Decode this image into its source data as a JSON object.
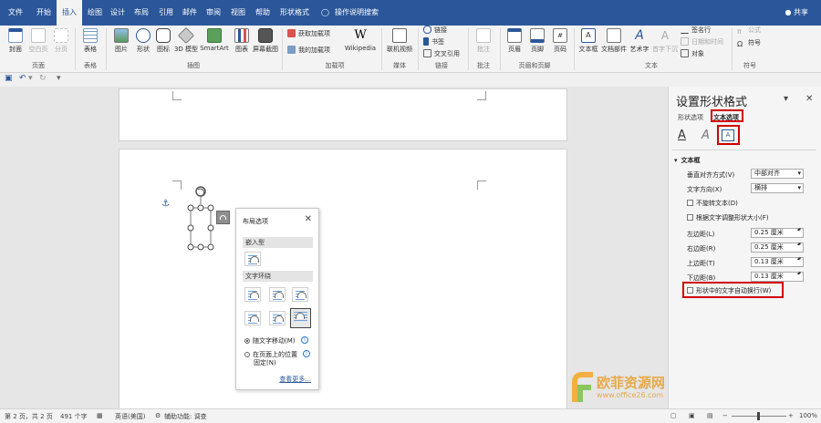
{
  "tabs": [
    "文件",
    "开始",
    "插入",
    "绘图",
    "设计",
    "布局",
    "引用",
    "邮件",
    "审阅",
    "视图",
    "帮助",
    "形状格式"
  ],
  "active_tab": "插入",
  "search_label": "操作说明搜索",
  "share_label": "共享",
  "ribbon": {
    "pages": {
      "cover": "封面",
      "blank": "空白页",
      "break": "分页",
      "group": "页面"
    },
    "tables": {
      "table": "表格",
      "group": "表格"
    },
    "illus": {
      "picture": "图片",
      "shapes": "形状",
      "icons": "图标",
      "model3d": "3D 模型",
      "smartart": "SmartArt",
      "chart": "图表",
      "screenshot": "屏幕截图",
      "group": "插图"
    },
    "addins": {
      "get": "获取加载项",
      "my": "我的加载项",
      "wikipedia": "Wikipedia",
      "group": "加载项"
    },
    "media": {
      "video": "联机视频",
      "group": "媒体"
    },
    "links": {
      "link": "链接",
      "bookmark": "书签",
      "crossref": "交叉引用",
      "group": "链接"
    },
    "comments": {
      "comment": "批注",
      "group": "批注"
    },
    "hf": {
      "header": "页眉",
      "footer": "页脚",
      "pagenum": "页码",
      "group": "页眉和页脚"
    },
    "text": {
      "textbox": "文本框",
      "parts": "文档部件",
      "wordart": "艺术字",
      "dropcap": "首字下沉",
      "signature": "签名行",
      "datetime": "日期和时间",
      "object": "对象",
      "group": "文本"
    },
    "symbols": {
      "equation": "公式",
      "symbol": "符号",
      "group": "符号"
    }
  },
  "layout_popup": {
    "title": "布局选项",
    "inline_section": "嵌入型",
    "wrap_section": "文字环绕",
    "move_with_text": "随文字移动(M)",
    "fix_position_line1": "在页面上的位置",
    "fix_position_line2": "固定(N)",
    "see_more": "查看更多..."
  },
  "format_pane": {
    "title": "设置形状格式",
    "tab_shape": "形状选项",
    "tab_text": "文本选项",
    "section": "文本框",
    "valign_label": "垂直对齐方式(V)",
    "valign_value": "中部对齐",
    "direction_label": "文字方向(X)",
    "direction_value": "横排",
    "no_rotate": "不旋转文本(D)",
    "autofit": "根据文字调整形状大小(F)",
    "left_margin_label": "左边距(L)",
    "left_margin_value": "0.25 厘米",
    "right_margin_label": "右边距(R)",
    "right_margin_value": "0.25 厘米",
    "top_margin_label": "上边距(T)",
    "top_margin_value": "0.13 厘米",
    "bottom_margin_label": "下边距(B)",
    "bottom_margin_value": "0.13 厘米",
    "wrap_text": "形状中的文字自动换行(W)"
  },
  "status": {
    "page": "第 2 页，共 2 页",
    "words": "491 个字",
    "lang": "英语(美国)",
    "access": "辅助功能: 调查",
    "zoom": "100%"
  },
  "watermark": {
    "brand": "欧菲资源网",
    "url": "www.office26.com"
  },
  "colors": {
    "accent": "#2b579a",
    "highlight": "#d00000"
  }
}
